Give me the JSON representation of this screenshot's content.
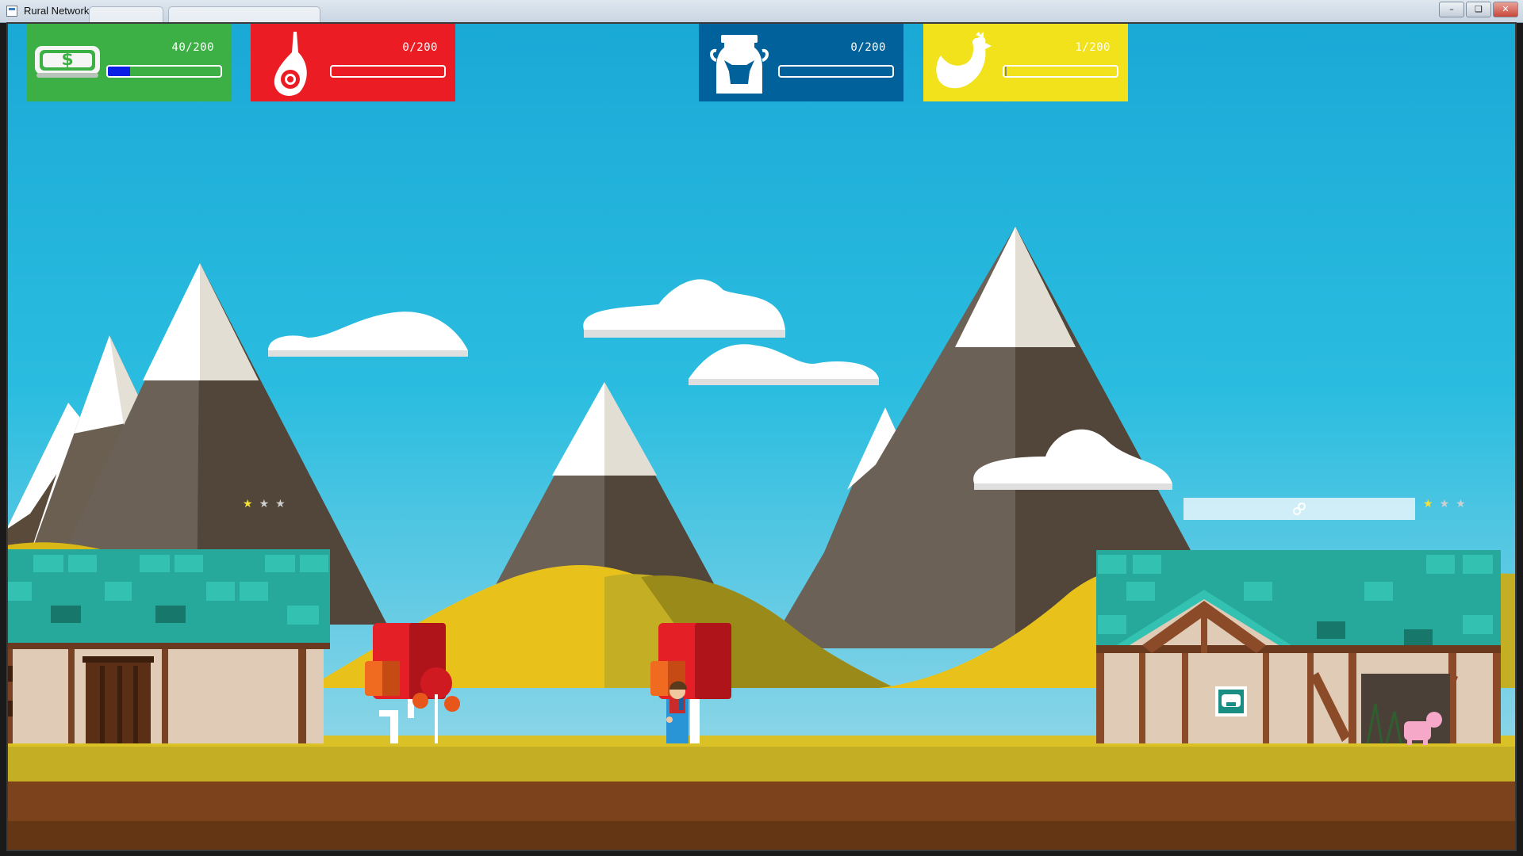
{
  "window": {
    "title": "Rural Network"
  },
  "hud": {
    "money": {
      "count": "40/200",
      "level": 0.2,
      "icon": "money-icon",
      "color": "#3cb044"
    },
    "meat": {
      "count": "0/200",
      "level": 0.0,
      "icon": "ham-icon",
      "color": "#ec1c24"
    },
    "milk": {
      "count": "0/200",
      "level": 0.0,
      "icon": "milk-can-icon",
      "color": "#01629b"
    },
    "egg": {
      "count": "1/200",
      "level": 0.005,
      "icon": "chicken-icon",
      "color": "#f1e21b"
    }
  },
  "buildings": {
    "left_house": {
      "stars_filled": 1,
      "stars_total": 3
    },
    "barn": {
      "stars_filled": 1,
      "stars_total": 3,
      "icon": "pig-sign-icon"
    }
  },
  "colors": {
    "sky_top": "#1aa9d6",
    "sky_bottom": "#a8dce9",
    "hill": "#e8c11a",
    "ground": "#c3ae24",
    "soil": "#7b421c",
    "roof": "#26a89a"
  }
}
